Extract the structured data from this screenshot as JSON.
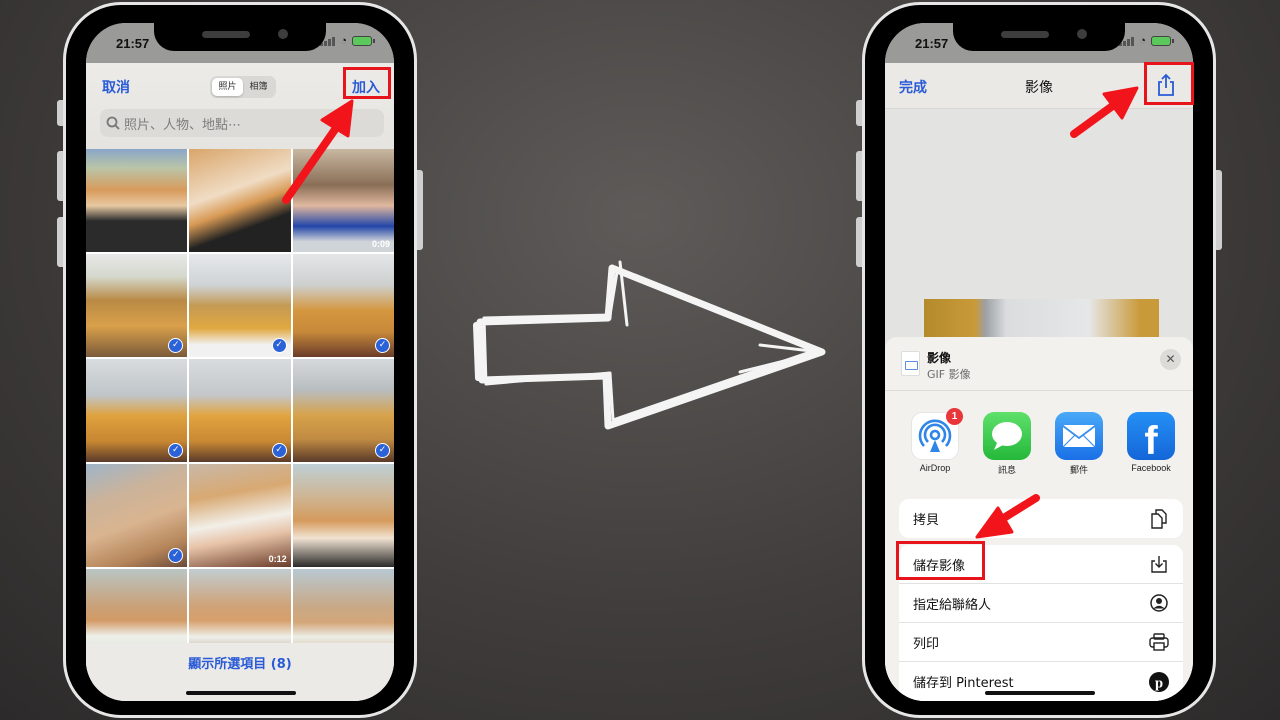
{
  "status_bar": {
    "time": "21:57"
  },
  "left_phone": {
    "header": {
      "cancel_label": "取消",
      "add_label": "加入",
      "segments": [
        {
          "label": "照片",
          "active": true
        },
        {
          "label": "相簿",
          "active": false
        }
      ],
      "search_placeholder": "照片、人物、地點⋯"
    },
    "photos": [
      {
        "duration": "",
        "selected": false
      },
      {
        "duration": "",
        "selected": false
      },
      {
        "duration": "0:09",
        "selected": false
      },
      {
        "duration": "",
        "selected": true
      },
      {
        "duration": "",
        "selected": true
      },
      {
        "duration": "",
        "selected": true
      },
      {
        "duration": "",
        "selected": true
      },
      {
        "duration": "",
        "selected": true
      },
      {
        "duration": "",
        "selected": true
      },
      {
        "duration": "",
        "selected": true
      },
      {
        "duration": "0:12",
        "selected": false
      },
      {
        "duration": "",
        "selected": false
      },
      {
        "duration": "",
        "selected": false
      },
      {
        "duration": "",
        "selected": false
      },
      {
        "duration": "",
        "selected": false
      }
    ],
    "footer_label": "顯示所選項目 (8)"
  },
  "right_phone": {
    "header": {
      "done_label": "完成",
      "title": "影像"
    },
    "share_sheet": {
      "title": "影像",
      "subtitle": "GIF 影像",
      "apps": [
        {
          "label": "AirDrop",
          "icon": "airdrop-icon",
          "badge": "1"
        },
        {
          "label": "訊息",
          "icon": "messages-icon"
        },
        {
          "label": "郵件",
          "icon": "mail-icon"
        },
        {
          "label": "Facebook",
          "icon": "facebook-icon"
        },
        {
          "label": "",
          "icon": "line-icon"
        }
      ],
      "actions_group1": [
        {
          "label": "拷貝",
          "icon": "copy-icon"
        }
      ],
      "actions_group2": [
        {
          "label": "儲存影像",
          "icon": "save-image-icon"
        },
        {
          "label": "指定給聯絡人",
          "icon": "contact-icon"
        },
        {
          "label": "列印",
          "icon": "printer-icon"
        },
        {
          "label": "儲存到 Pinterest",
          "icon": "pinterest-icon"
        }
      ]
    }
  },
  "colors": {
    "accent": "#2a5bd7",
    "highlight": "#e8141b",
    "check": "#2b62d8"
  }
}
